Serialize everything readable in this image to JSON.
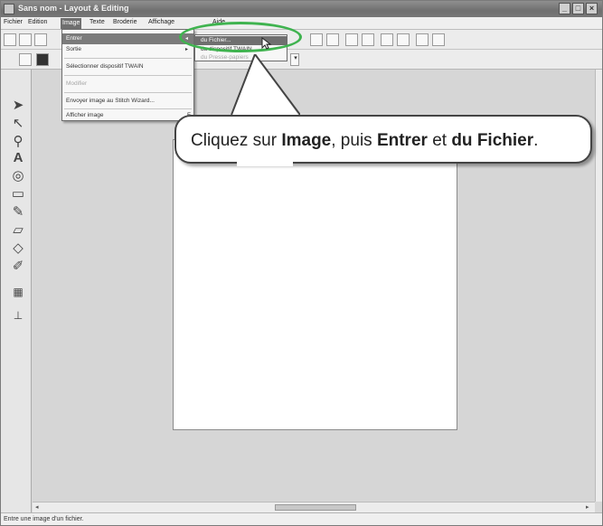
{
  "window": {
    "title": "Sans nom - Layout & Editing",
    "controls": [
      "_",
      "□",
      "×"
    ]
  },
  "menubar": {
    "items": [
      {
        "label": "Fichier"
      },
      {
        "label": "Edition"
      },
      {
        "label": "Image",
        "active": true
      },
      {
        "label": "Texte"
      },
      {
        "label": "Broderie"
      },
      {
        "label": "Affichage"
      },
      {
        "label": "Aide"
      }
    ]
  },
  "image_menu": {
    "items": [
      {
        "label": "Entrer",
        "active": true,
        "submenu": true
      },
      {
        "label": "Sortie",
        "submenu": true
      },
      {
        "label": "Sélectionner dispositif TWAIN"
      },
      {
        "label": "Modifier",
        "disabled": true
      },
      {
        "label": "Envoyer image au Stitch Wizard..."
      },
      {
        "label": "Afficher image",
        "shortcut": "F"
      }
    ]
  },
  "entrer_submenu": {
    "items": [
      {
        "label": "du Fichier...",
        "active": true
      },
      {
        "label": "du dispositif TWAIN..."
      },
      {
        "label": "du Presse-papiers",
        "disabled": true
      }
    ]
  },
  "callout": {
    "part1": "Cliquez sur ",
    "bold1": "Image",
    "part2": ", puis ",
    "bold2": "Entrer",
    "part3": " et ",
    "bold3": "du Fichier",
    "part4": "."
  },
  "statusbar": {
    "text": "Entre une image d'un fichier."
  },
  "colors": {
    "highlight": "#3fb34f"
  }
}
